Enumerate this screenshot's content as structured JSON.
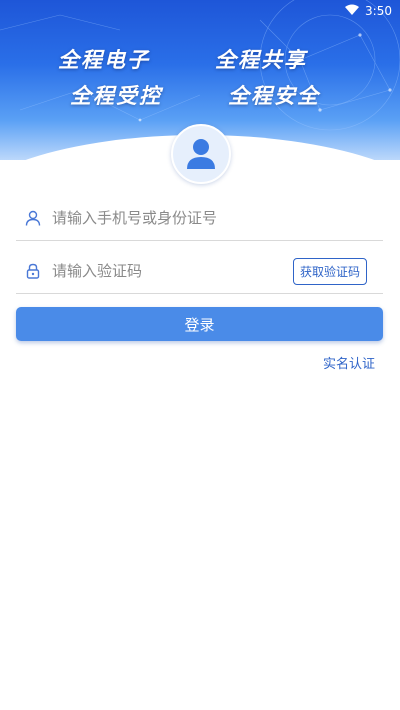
{
  "status_bar": {
    "time": "3:50",
    "wifi_icon": "wifi-icon"
  },
  "banner": {
    "slogans": [
      "全程电子",
      "全程共享",
      "全程受控",
      "全程安全"
    ]
  },
  "login": {
    "phone_placeholder": "请输入手机号或身份证号",
    "phone_icon": "user-icon",
    "code_placeholder": "请输入验证码",
    "code_icon": "lock-icon",
    "get_code_label": "获取验证码",
    "submit_label": "登录",
    "realname_label": "实名认证"
  },
  "colors": {
    "primary": "#4a8be8",
    "link": "#2f64c8",
    "banner_top": "#1e56d8"
  }
}
